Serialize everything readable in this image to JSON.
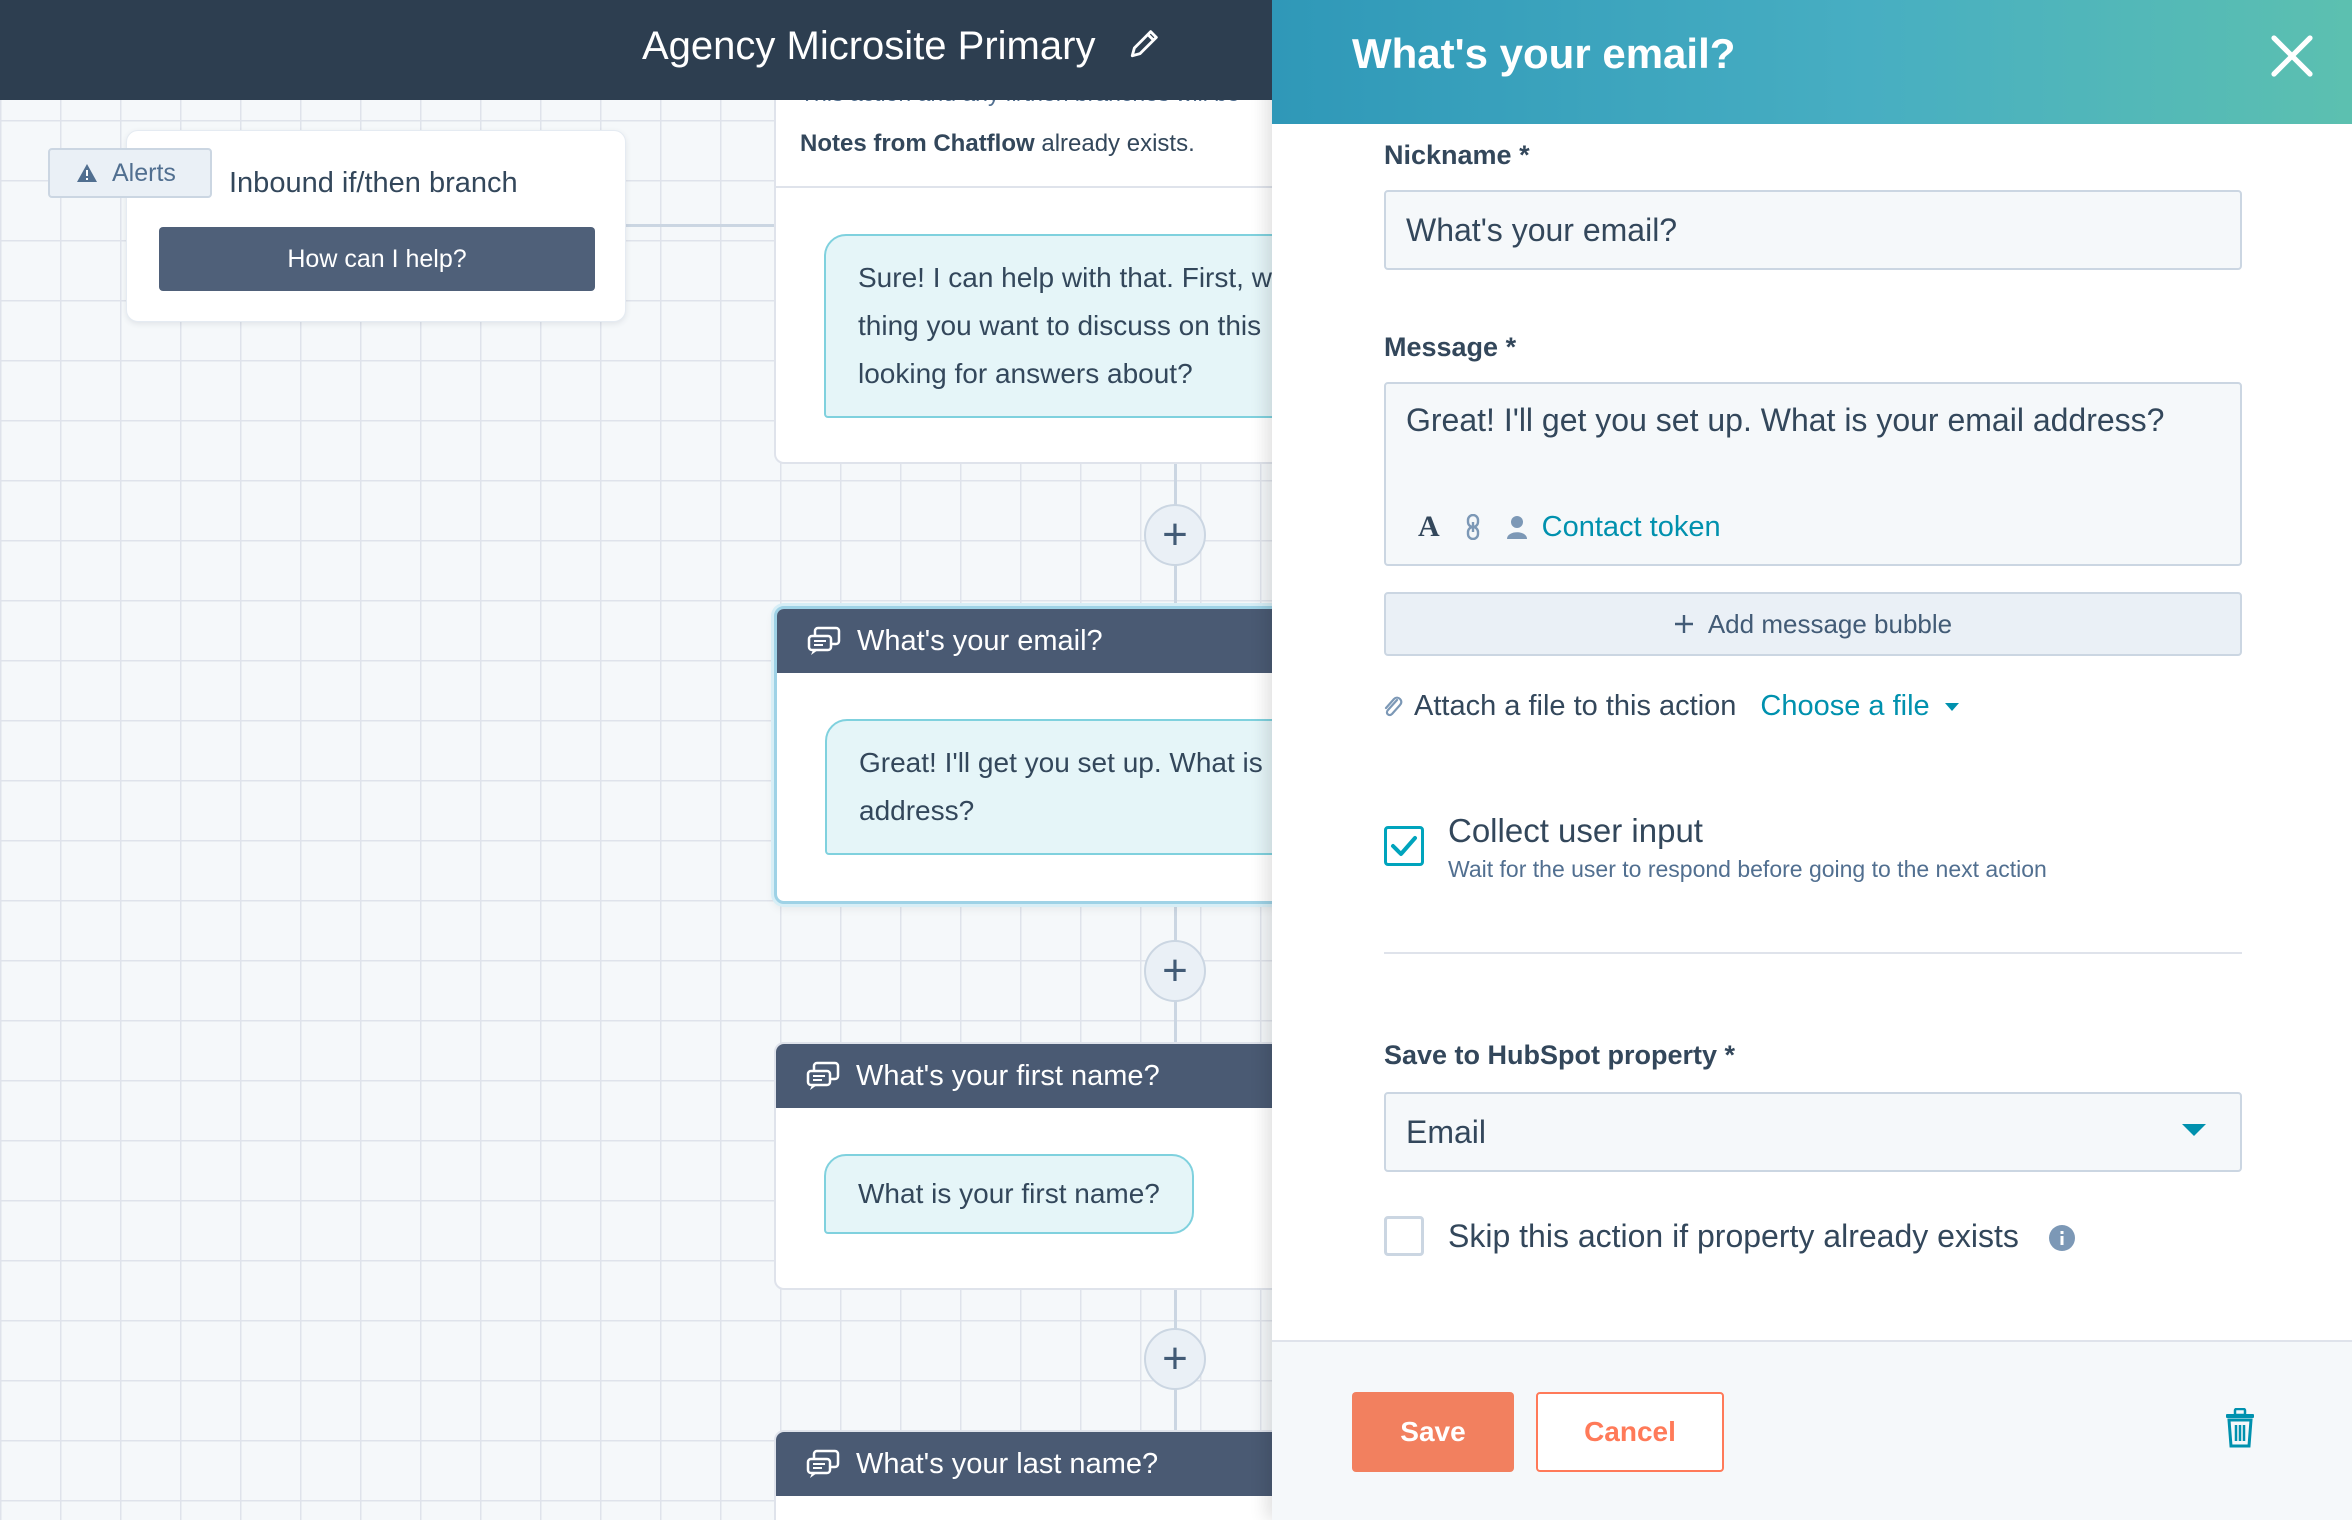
{
  "topbar": {
    "title": "Agency Microsite Primary"
  },
  "canvas": {
    "alerts_label": "Alerts",
    "branch": {
      "title": "Inbound if/then branch",
      "button": "How can I help?"
    },
    "partial_node": {
      "clipped_text": "This action and any if/then branches will be",
      "note_bold": "Notes from Chatflow",
      "note_rest": " already exists.",
      "bubble_lines": [
        "Sure! I can help with that. First, w",
        "thing you want to discuss on this",
        "looking for answers about?"
      ]
    },
    "nodes": [
      {
        "title": "What's your email?",
        "bubble_lines": [
          "Great! I'll get you set up. What is",
          "address?"
        ]
      },
      {
        "title": "What's your first name?",
        "bubble_lines": [
          "What is your first name?"
        ]
      },
      {
        "title": "What's your last name?",
        "bubble_lines": []
      }
    ],
    "add_step_symbol": "+"
  },
  "panel": {
    "title": "What's your email?",
    "nickname": {
      "label": "Nickname *",
      "value": "What's your email?"
    },
    "message": {
      "label": "Message *",
      "value": "Great! I'll get you set up. What is your email address?",
      "toolbar_text_glyph": "A",
      "contact_token": "Contact token"
    },
    "add_bubble_label": "Add message bubble",
    "attach": {
      "label": "Attach a file to this action",
      "choose": "Choose a file"
    },
    "collect": {
      "checked": true,
      "title": "Collect user input",
      "subtitle": "Wait for the user to respond before going to the next action"
    },
    "save_property": {
      "label": "Save to HubSpot property *",
      "value": "Email"
    },
    "skip": {
      "checked": false,
      "label": "Skip this action if property already exists"
    },
    "footer": {
      "save": "Save",
      "cancel": "Cancel"
    }
  },
  "colors": {
    "topbar": "#2d3e50",
    "node_header": "#4a5a73",
    "accent_teal": "#0091ae",
    "save_button": "#f2805f",
    "cancel_border": "#ff7a59"
  },
  "icons": [
    "pencil-icon",
    "warning-icon",
    "chat-bubbles-icon",
    "close-icon",
    "link-icon",
    "person-icon",
    "plus-icon",
    "paperclip-icon",
    "caret-down-icon",
    "checkmark-icon",
    "info-icon",
    "trash-icon"
  ]
}
